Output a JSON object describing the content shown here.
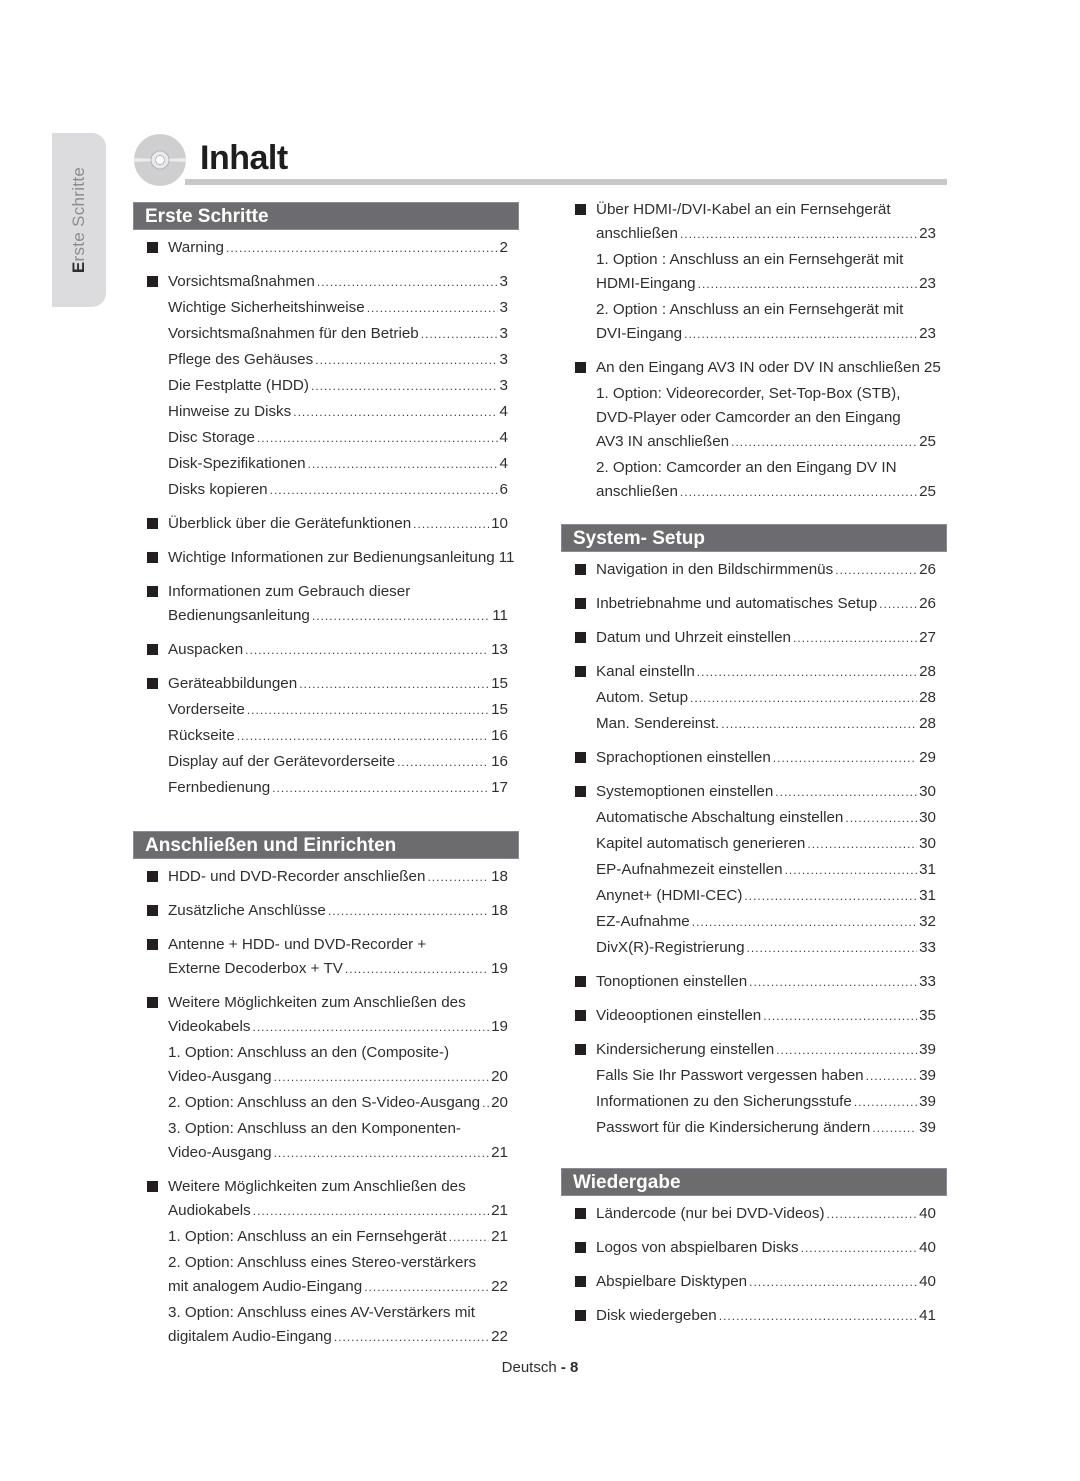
{
  "side_tab": {
    "first_letter": "E",
    "rest": "rste Schritte"
  },
  "header": {
    "title": "Inhalt",
    "icon": "disc-icon"
  },
  "colors": {
    "section_bar": "#6c6c6e",
    "side_tab": "#dcdcde",
    "title_rule": "#c8c8cb",
    "bullet": "#231f20"
  },
  "sections": [
    {
      "title": "Erste Schritte",
      "column": "left",
      "entries": [
        {
          "bullet": true,
          "lines": [
            {
              "text": "Warning",
              "page": "2"
            }
          ]
        },
        {
          "bullet": true,
          "lines": [
            {
              "text": "Vorsichtsmaßnahmen",
              "page": "3"
            }
          ]
        },
        {
          "bullet": false,
          "lines": [
            {
              "text": "Wichtige Sicherheitshinweise",
              "page": "3"
            }
          ]
        },
        {
          "bullet": false,
          "lines": [
            {
              "text": "Vorsichtsmaßnahmen für den Betrieb",
              "page": "3"
            }
          ]
        },
        {
          "bullet": false,
          "lines": [
            {
              "text": "Pflege des Gehäuses",
              "page": "3"
            }
          ]
        },
        {
          "bullet": false,
          "lines": [
            {
              "text": "Die Festplatte (HDD)",
              "page": "3"
            }
          ]
        },
        {
          "bullet": false,
          "lines": [
            {
              "text": "Hinweise zu Disks",
              "page": "4"
            }
          ]
        },
        {
          "bullet": false,
          "lines": [
            {
              "text": "Disc Storage",
              "page": "4"
            }
          ]
        },
        {
          "bullet": false,
          "lines": [
            {
              "text": "Disk-Spezifikationen",
              "page": "4"
            }
          ]
        },
        {
          "bullet": false,
          "lines": [
            {
              "text": "Disks kopieren",
              "page": "6"
            }
          ]
        },
        {
          "bullet": true,
          "lines": [
            {
              "text": "Überblick über die Gerätefunktionen",
              "page": "10"
            }
          ]
        },
        {
          "bullet": true,
          "lines": [
            {
              "text": "Wichtige Informationen zur Bedienungsanleitung",
              "page": "11"
            }
          ]
        },
        {
          "bullet": true,
          "lines": [
            {
              "text": "Informationen zum Gebrauch dieser",
              "page": ""
            },
            {
              "text": "Bedienungsanleitung",
              "page": "11"
            }
          ]
        },
        {
          "bullet": true,
          "lines": [
            {
              "text": "Auspacken",
              "page": "13"
            }
          ]
        },
        {
          "bullet": true,
          "lines": [
            {
              "text": "Geräteabbildungen",
              "page": "15"
            }
          ]
        },
        {
          "bullet": false,
          "lines": [
            {
              "text": "Vorderseite",
              "page": "15"
            }
          ]
        },
        {
          "bullet": false,
          "lines": [
            {
              "text": "Rückseite",
              "page": "16"
            }
          ]
        },
        {
          "bullet": false,
          "lines": [
            {
              "text": "Display auf der Gerätevorderseite",
              "page": "16"
            }
          ]
        },
        {
          "bullet": false,
          "lines": [
            {
              "text": "Fernbedienung",
              "page": "17"
            }
          ]
        }
      ]
    },
    {
      "title": "Anschließen und Einrichten",
      "column": "left",
      "entries": [
        {
          "bullet": true,
          "lines": [
            {
              "text": "HDD- und DVD-Recorder anschließen",
              "page": "18"
            }
          ]
        },
        {
          "bullet": true,
          "lines": [
            {
              "text": "Zusätzliche Anschlüsse",
              "page": "18"
            }
          ]
        },
        {
          "bullet": true,
          "lines": [
            {
              "text": "Antenne + HDD- und DVD-Recorder +",
              "page": ""
            },
            {
              "text": "Externe Decoderbox + TV",
              "page": "19"
            }
          ]
        },
        {
          "bullet": true,
          "lines": [
            {
              "text": "Weitere Möglichkeiten zum Anschließen des",
              "page": ""
            },
            {
              "text": "Videokabels",
              "page": "19"
            }
          ]
        },
        {
          "bullet": false,
          "lines": [
            {
              "text": "1. Option: Anschluss an den (Composite-)",
              "page": ""
            },
            {
              "text": "Video-Ausgang",
              "page": "20"
            }
          ]
        },
        {
          "bullet": false,
          "lines": [
            {
              "text": "2. Option: Anschluss an den S-Video-Ausgang",
              "page": "20"
            }
          ]
        },
        {
          "bullet": false,
          "lines": [
            {
              "text": "3. Option: Anschluss an den Komponenten-",
              "page": ""
            },
            {
              "text": "Video-Ausgang",
              "page": "21"
            }
          ]
        },
        {
          "bullet": true,
          "lines": [
            {
              "text": "Weitere Möglichkeiten zum Anschließen des",
              "page": ""
            },
            {
              "text": "Audiokabels",
              "page": "21"
            }
          ]
        },
        {
          "bullet": false,
          "lines": [
            {
              "text": "1. Option: Anschluss an ein Fernsehgerät",
              "page": "21"
            }
          ]
        },
        {
          "bullet": false,
          "lines": [
            {
              "text": "2. Option: Anschluss eines Stereo-verstärkers",
              "page": ""
            },
            {
              "text": "mit analogem Audio-Eingang",
              "page": "22"
            }
          ]
        },
        {
          "bullet": false,
          "lines": [
            {
              "text": "3. Option: Anschluss eines AV-Verstärkers mit",
              "page": ""
            },
            {
              "text": "digitalem Audio-Eingang",
              "page": "22"
            }
          ]
        }
      ]
    },
    {
      "title": "",
      "column": "right",
      "entries": [
        {
          "bullet": true,
          "lines": [
            {
              "text": "Über HDMI-/DVI-Kabel an ein Fernsehgerät",
              "page": ""
            },
            {
              "text": "anschließen",
              "page": "23"
            }
          ]
        },
        {
          "bullet": false,
          "lines": [
            {
              "text": "1. Option : Anschluss an ein Fernsehgerät mit",
              "page": ""
            },
            {
              "text": "HDMI-Eingang",
              "page": "23"
            }
          ]
        },
        {
          "bullet": false,
          "lines": [
            {
              "text": "2. Option : Anschluss an ein Fernsehgerät mit",
              "page": ""
            },
            {
              "text": "DVI-Eingang",
              "page": "23"
            }
          ]
        },
        {
          "bullet": true,
          "lines": [
            {
              "text": "An den Eingang AV3 IN oder DV IN anschließen",
              "page": "25"
            }
          ]
        },
        {
          "bullet": false,
          "lines": [
            {
              "text": "1. Option: Videorecorder, Set-Top-Box (STB),",
              "page": ""
            },
            {
              "text": "DVD-Player oder Camcorder an den Eingang",
              "page": ""
            },
            {
              "text": "AV3 IN anschließen",
              "page": "25"
            }
          ]
        },
        {
          "bullet": false,
          "lines": [
            {
              "text": "2. Option: Camcorder an den Eingang DV IN",
              "page": ""
            },
            {
              "text": "anschließen",
              "page": "25"
            }
          ]
        }
      ]
    },
    {
      "title": "System- Setup",
      "column": "right",
      "entries": [
        {
          "bullet": true,
          "lines": [
            {
              "text": "Navigation in den Bildschirmmenüs",
              "page": "26"
            }
          ]
        },
        {
          "bullet": true,
          "lines": [
            {
              "text": "Inbetriebnahme und automatisches Setup",
              "page": "26"
            }
          ]
        },
        {
          "bullet": true,
          "lines": [
            {
              "text": "Datum und Uhrzeit einstellen",
              "page": "27"
            }
          ]
        },
        {
          "bullet": true,
          "lines": [
            {
              "text": "Kanal einstelln",
              "page": "28"
            }
          ]
        },
        {
          "bullet": false,
          "lines": [
            {
              "text": "Autom. Setup",
              "page": "28"
            }
          ]
        },
        {
          "bullet": false,
          "lines": [
            {
              "text": "Man. Sendereinst.",
              "page": "28"
            }
          ]
        },
        {
          "bullet": true,
          "lines": [
            {
              "text": "Sprachoptionen einstellen",
              "page": "29"
            }
          ]
        },
        {
          "bullet": true,
          "lines": [
            {
              "text": "Systemoptionen einstellen",
              "page": "30"
            }
          ]
        },
        {
          "bullet": false,
          "lines": [
            {
              "text": "Automatische Abschaltung einstellen",
              "page": "30"
            }
          ]
        },
        {
          "bullet": false,
          "lines": [
            {
              "text": "Kapitel automatisch generieren",
              "page": "30"
            }
          ]
        },
        {
          "bullet": false,
          "lines": [
            {
              "text": "EP-Aufnahmezeit einstellen",
              "page": "31"
            }
          ]
        },
        {
          "bullet": false,
          "lines": [
            {
              "text": "Anynet+ (HDMI-CEC)",
              "page": "31"
            }
          ]
        },
        {
          "bullet": false,
          "lines": [
            {
              "text": "EZ-Aufnahme",
              "page": "32"
            }
          ]
        },
        {
          "bullet": false,
          "lines": [
            {
              "text": "DivX(R)-Registrierung",
              "page": "33"
            }
          ]
        },
        {
          "bullet": true,
          "lines": [
            {
              "text": "Tonoptionen einstellen",
              "page": "33"
            }
          ]
        },
        {
          "bullet": true,
          "lines": [
            {
              "text": "Videooptionen einstellen",
              "page": "35"
            }
          ]
        },
        {
          "bullet": true,
          "lines": [
            {
              "text": "Kindersicherung einstellen",
              "page": "39"
            }
          ]
        },
        {
          "bullet": false,
          "lines": [
            {
              "text": "Falls Sie Ihr Passwort vergessen haben",
              "page": "39"
            }
          ]
        },
        {
          "bullet": false,
          "lines": [
            {
              "text": "Informationen zu den Sicherungsstufe",
              "page": "39"
            }
          ]
        },
        {
          "bullet": false,
          "lines": [
            {
              "text": "Passwort für die Kindersicherung ändern",
              "page": "39"
            }
          ]
        }
      ]
    },
    {
      "title": "Wiedergabe",
      "column": "right",
      "entries": [
        {
          "bullet": true,
          "lines": [
            {
              "text": "Ländercode (nur bei DVD-Videos)",
              "page": "40"
            }
          ]
        },
        {
          "bullet": true,
          "lines": [
            {
              "text": "Logos von abspielbaren Disks",
              "page": "40"
            }
          ]
        },
        {
          "bullet": true,
          "lines": [
            {
              "text": "Abspielbare Disktypen",
              "page": "40"
            }
          ]
        },
        {
          "bullet": true,
          "lines": [
            {
              "text": "Disk wiedergeben",
              "page": "41"
            }
          ]
        }
      ]
    }
  ],
  "footer": {
    "language": "Deutsch",
    "separator": " - ",
    "page_number": "8"
  }
}
